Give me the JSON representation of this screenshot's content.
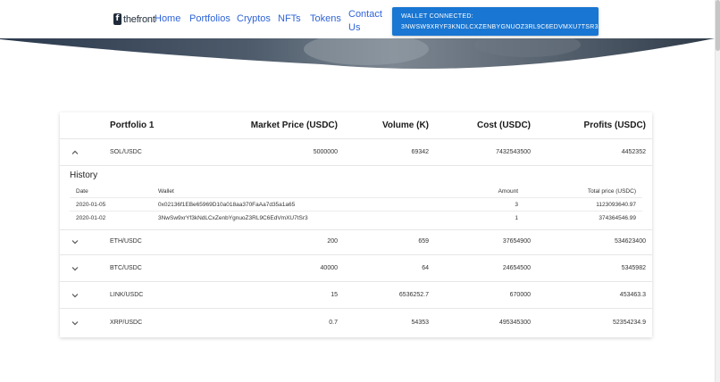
{
  "header": {
    "logo_brand": "thefront",
    "logo_mark": "f",
    "nav": {
      "home": "Home",
      "portfolios": "Portfolios",
      "cryptos": "Cryptos",
      "nfts": "NFTs",
      "tokens": "Tokens",
      "contact_line1": "Contact",
      "contact_line2": "Us"
    },
    "wallet": {
      "line1": "WALLET CONNECTED:",
      "line2": "3NWSW9XRYF3KNDLCXZENBYGNUOZ3RL9C6EDVMXU7TSR3"
    }
  },
  "table": {
    "columns": {
      "name": "Portfolio 1",
      "market_price": "Market Price (USDC)",
      "volume": "Volume (K)",
      "cost": "Cost (USDC)",
      "profits": "Profits (USDC)"
    },
    "rows": [
      {
        "pair": "SOL/USDC",
        "market_price": "5000000",
        "volume": "69342",
        "cost": "7432543500",
        "profits": "4452352",
        "expanded": true,
        "chevron": "chevron-up-icon"
      },
      {
        "pair": "ETH/USDC",
        "market_price": "200",
        "volume": "659",
        "cost": "37654900",
        "profits": "534623400",
        "expanded": false,
        "chevron": "chevron-down-icon"
      },
      {
        "pair": "BTC/USDC",
        "market_price": "40000",
        "volume": "64",
        "cost": "24654500",
        "profits": "5345982",
        "expanded": false,
        "chevron": "chevron-down-icon"
      },
      {
        "pair": "LINK/USDC",
        "market_price": "15",
        "volume": "6536252.7",
        "cost": "670000",
        "profits": "453463.3",
        "expanded": false,
        "chevron": "chevron-down-icon"
      },
      {
        "pair": "XRP/USDC",
        "market_price": "0.7",
        "volume": "54353",
        "cost": "495345300",
        "profits": "52354234.9",
        "expanded": false,
        "chevron": "chevron-down-icon"
      }
    ],
    "history": {
      "title": "History",
      "columns": {
        "date": "Date",
        "wallet": "Wallet",
        "amount": "Amount",
        "total_price": "Total price (USDC)"
      },
      "rows": [
        {
          "date": "2020-01-05",
          "wallet": "0x02136f1EBe65969D10a018aa370FaAa7d35a1a65",
          "amount": "3",
          "total_price": "1123093640.97"
        },
        {
          "date": "2020-01-02",
          "wallet": "3NwSw9xrYf3kNdLCxZenbYgnuoZ3RL9C6EdVmXU7tSr3",
          "amount": "1",
          "total_price": "374364546.99"
        }
      ]
    }
  },
  "colors": {
    "nav_link": "#2f64d8",
    "wallet_button": "#1976d2",
    "logo": "#1f2b3a"
  }
}
